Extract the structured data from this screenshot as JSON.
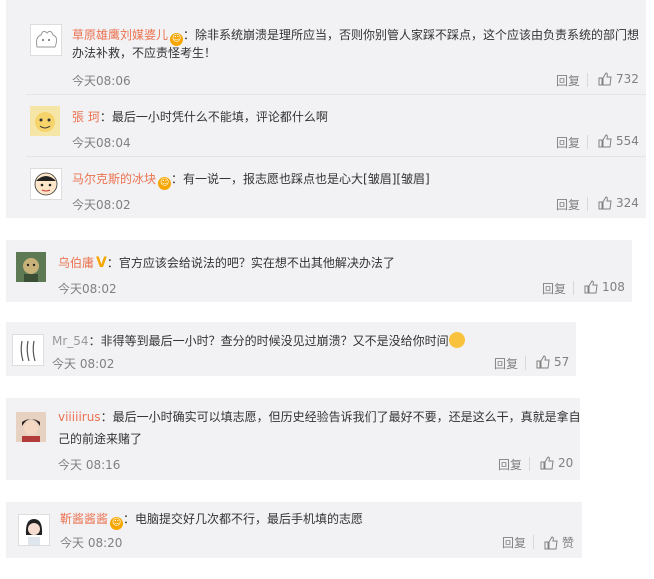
{
  "reply_label": "回复",
  "comments": [
    {
      "user": "草原雄鹰刘媒婆儿",
      "badge": "☺",
      "text_line1": "：除非系统崩溃是理所应当，否则你别管人家踩不踩点，这个应该由负责系统的部门想",
      "text_line2": "办法补救，不应责怪考生！",
      "time": "今天08:06",
      "likes": "732"
    },
    {
      "user": "張 珂",
      "text_line1": "：最后一小时凭什么不能填，评论都什么啊",
      "time": "今天08:04",
      "likes": "554"
    },
    {
      "user": "马尔克斯的冰块",
      "badge": "☺",
      "text_line1": "：有一说一，报志愿也踩点也是心大[皱眉][皱眉]",
      "time": "今天08:02",
      "likes": "324"
    },
    {
      "user": "乌伯庸",
      "vbadge": "V",
      "text_line1": "：官方应该会给说法的吧？实在想不出其他解决办法了",
      "time": "今天08:02",
      "likes": "108"
    },
    {
      "user": "Mr_54",
      "text_line1": "：非得等到最后一小时？查分的时候没见过崩溃？又不是没给你时间",
      "time": "今天 08:02",
      "likes": "57"
    },
    {
      "user": "viiiiirus",
      "text_line1": "：最后一小时确实可以填志愿，但历史经验告诉我们了最好不要，还是这么干，真就是拿自",
      "text_line2": "己的前途来赌了",
      "time": "今天 08:16",
      "likes": "20"
    },
    {
      "user": "靳酱酱酱",
      "badge": "☺",
      "text_line1": "：电脑提交好几次都不行，最后手机填的志愿",
      "time": "今天 08:20",
      "likes": "赞"
    }
  ],
  "colors": {
    "username": "#eb7350",
    "card_bg": "#f2f2f5",
    "meta": "#808080",
    "badge": "#f7a600"
  }
}
